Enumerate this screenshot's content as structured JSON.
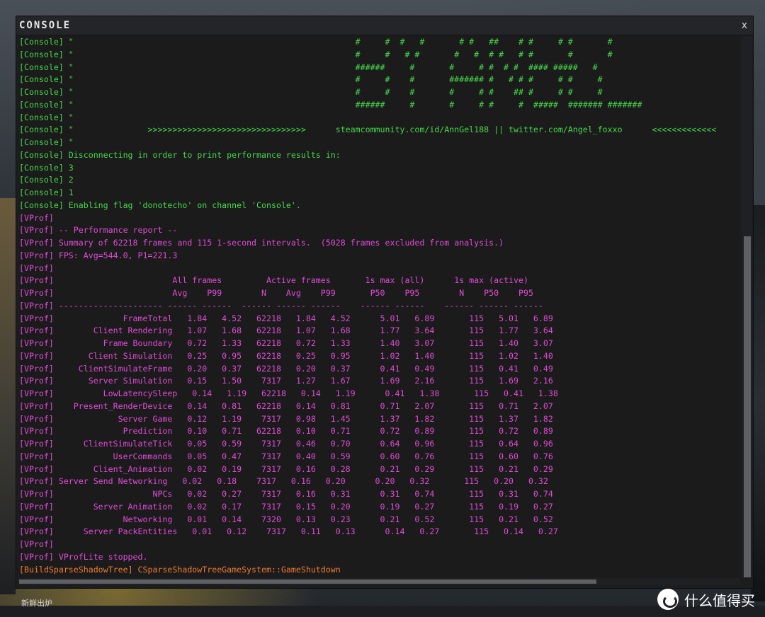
{
  "window": {
    "title": "CONSOLE",
    "close_label": "x"
  },
  "background": {
    "bottom_tag": "新鲜出炉",
    "watermark": "什么值得买"
  },
  "lines": [
    {
      "color": "green",
      "text": "[Console] \"                                                         #     #  #   #       # #   ##    # #     # #       #"
    },
    {
      "color": "green",
      "text": "[Console] \"                                                         #     #   # #       #   #  # #   # #       #       #"
    },
    {
      "color": "green",
      "text": "[Console] \"                                                         ######     #       #     # #  # #  #### #####   #"
    },
    {
      "color": "green",
      "text": "[Console] \"                                                         #     #    #       ####### #   # # #     # #     #"
    },
    {
      "color": "green",
      "text": "[Console] \"                                                         #     #    #       #     # #    ## #     # #     #"
    },
    {
      "color": "green",
      "text": "[Console] \"                                                         ######     #       #     # #     #  #####  ####### #######"
    },
    {
      "color": "green",
      "text": "[Console] \""
    },
    {
      "color": "green",
      "text": "[Console] \"               >>>>>>>>>>>>>>>>>>>>>>>>>>>>>>>>      steamcommunity.com/id/AnnGel188 || twitter.com/Angel_foxxo      <<<<<<<<<<<<<"
    },
    {
      "color": "green",
      "text": "[Console] \""
    },
    {
      "color": "green",
      "text": "[Console] Disconnecting in order to print performance results in:"
    },
    {
      "color": "green",
      "text": "[Console] 3"
    },
    {
      "color": "green",
      "text": "[Console] 2"
    },
    {
      "color": "green",
      "text": "[Console] 1"
    },
    {
      "color": "green",
      "text": "[Console] Enabling flag 'donotecho' on channel 'Console'."
    },
    {
      "color": "magenta",
      "text": "[VProf]"
    },
    {
      "color": "magenta",
      "text": "[VProf] -- Performance report --"
    },
    {
      "color": "magenta",
      "text": "[VProf] Summary of 62218 frames and 115 1-second intervals.  (5028 frames excluded from analysis.)"
    },
    {
      "color": "magenta",
      "text": "[VProf] FPS: Avg=544.0, P1=221.3"
    },
    {
      "color": "magenta",
      "text": "[VProf]"
    },
    {
      "color": "magenta",
      "text": "[VProf]                        All frames         Active frames       1s max (all)      1s max (active)"
    },
    {
      "color": "magenta",
      "text": "[VProf]                        Avg    P99        N    Avg    P99       P50    P95        N    P50    P95"
    },
    {
      "color": "magenta",
      "text": "[VProf] --------------------- ------ ------  ------ ------ ------    ------ ------    ------ ------ ------"
    },
    {
      "color": "magenta",
      "text": "[VProf]              FrameTotal   1.84   4.52   62218   1.84   4.52      5.01   6.89       115   5.01   6.89"
    },
    {
      "color": "magenta",
      "text": "[VProf]        Client Rendering   1.07   1.68   62218   1.07   1.68      1.77   3.64       115   1.77   3.64"
    },
    {
      "color": "magenta",
      "text": "[VProf]          Frame Boundary   0.72   1.33   62218   0.72   1.33      1.40   3.07       115   1.40   3.07"
    },
    {
      "color": "magenta",
      "text": "[VProf]       Client Simulation   0.25   0.95   62218   0.25   0.95      1.02   1.40       115   1.02   1.40"
    },
    {
      "color": "magenta",
      "text": "[VProf]     ClientSimulateFrame   0.20   0.37   62218   0.20   0.37      0.41   0.49       115   0.41   0.49"
    },
    {
      "color": "magenta",
      "text": "[VProf]       Server Simulation   0.15   1.50    7317   1.27   1.67      1.69   2.16       115   1.69   2.16"
    },
    {
      "color": "magenta",
      "text": "[VProf]          LowLatencySleep   0.14   1.19   62218   0.14   1.19      0.41   1.38       115   0.41   1.38"
    },
    {
      "color": "magenta",
      "text": "[VProf]    Present_RenderDevice   0.14   0.81   62218   0.14   0.81      0.71   2.07       115   0.71   2.07"
    },
    {
      "color": "magenta",
      "text": "[VProf]             Server Game   0.12   1.19    7317   0.98   1.45      1.37   1.82       115   1.37   1.82"
    },
    {
      "color": "magenta",
      "text": "[VProf]              Prediction   0.10   0.71   62218   0.10   0.71      0.72   0.89       115   0.72   0.89"
    },
    {
      "color": "magenta",
      "text": "[VProf]      ClientSimulateTick   0.05   0.59    7317   0.46   0.70      0.64   0.96       115   0.64   0.96"
    },
    {
      "color": "magenta",
      "text": "[VProf]            UserCommands   0.05   0.47    7317   0.40   0.59      0.60   0.76       115   0.60   0.76"
    },
    {
      "color": "magenta",
      "text": "[VProf]        Client_Animation   0.02   0.19    7317   0.16   0.28      0.21   0.29       115   0.21   0.29"
    },
    {
      "color": "magenta",
      "text": "[VProf] Server Send Networking   0.02   0.18    7317   0.16   0.20      0.20   0.32       115   0.20   0.32"
    },
    {
      "color": "magenta",
      "text": "[VProf]                    NPCs   0.02   0.27    7317   0.16   0.31      0.31   0.74       115   0.31   0.74"
    },
    {
      "color": "magenta",
      "text": "[VProf]        Server Animation   0.02   0.17    7317   0.15   0.20      0.19   0.27       115   0.19   0.27"
    },
    {
      "color": "magenta",
      "text": "[VProf]              Networking   0.01   0.14    7320   0.13   0.23      0.21   0.52       115   0.21   0.52"
    },
    {
      "color": "magenta",
      "text": "[VProf]      Server PackEntities   0.01   0.12    7317   0.11   0.13      0.14   0.27       115   0.14   0.27"
    },
    {
      "color": "magenta",
      "text": "[VProf]"
    },
    {
      "color": "magenta",
      "text": "[VProf] VProfLite stopped."
    },
    {
      "color": "orange",
      "text": "[BuildSparseShadowTree] CSparseShadowTreeGameSystem::GameShutdown"
    }
  ]
}
